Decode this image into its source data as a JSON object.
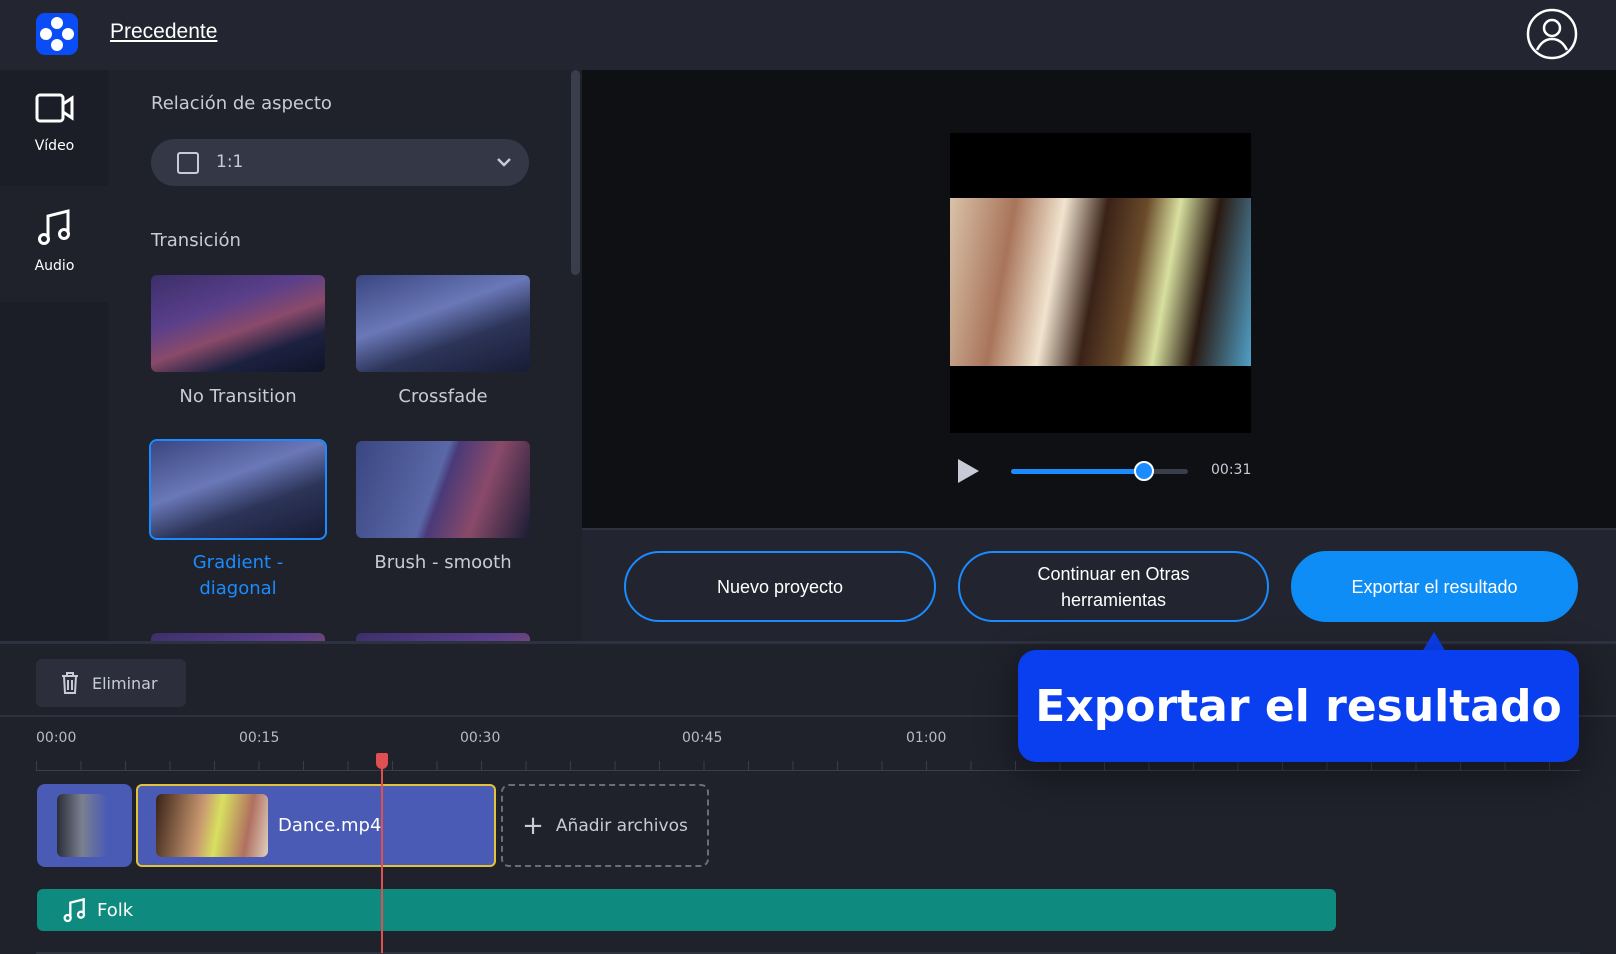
{
  "header": {
    "back_label": "Precedente"
  },
  "nav": [
    {
      "label": "Vídeo"
    },
    {
      "label": "Audio"
    }
  ],
  "panel": {
    "aspect_label": "Relación de aspecto",
    "aspect_value": "1:1",
    "transition_label": "Transición",
    "transitions": [
      {
        "label": "No Transition",
        "selected": false
      },
      {
        "label": "Crossfade",
        "selected": false
      },
      {
        "label": "Gradient - diagonal",
        "selected": true
      },
      {
        "label": "Brush - smooth",
        "selected": false
      }
    ]
  },
  "player": {
    "time": "00:31",
    "progress": 0.75
  },
  "actions": {
    "new_project": "Nuevo proyecto",
    "continue": "Continuar en Otras herramientas",
    "export": "Exportar el resultado"
  },
  "timeline": {
    "delete_label": "Eliminar",
    "ticks": [
      "00:00",
      "00:15",
      "00:30",
      "00:45",
      "01:00"
    ],
    "clip_name": "Dance.mp4",
    "add_files": "Añadir archivos",
    "audio_name": "Folk"
  },
  "tooltip": {
    "text": "Exportar el resultado"
  },
  "colors": {
    "accent": "#1a8cff",
    "tooltip": "#0a3ff0",
    "audio": "#0f8a7e",
    "clip": "#4a5bb5",
    "playhead": "#e05050"
  }
}
